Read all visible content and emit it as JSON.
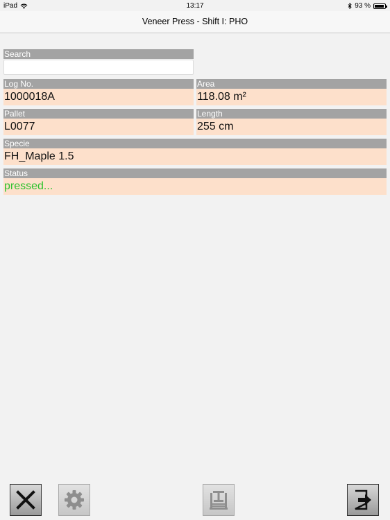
{
  "status_bar": {
    "device": "iPad",
    "time": "13:17",
    "battery": "93 %",
    "battery_level": 0.93
  },
  "header": {
    "title": "Veneer Press - Shift I: PHO"
  },
  "search": {
    "label": "Search",
    "value": "",
    "placeholder": ""
  },
  "fields": {
    "log_no": {
      "label": "Log No.",
      "value": "1000018A"
    },
    "area": {
      "label": "Area",
      "value": "118.08 m²"
    },
    "pallet": {
      "label": "Pallet",
      "value": "L0077"
    },
    "length": {
      "label": "Length",
      "value": "255 cm"
    },
    "specie": {
      "label": "Specie",
      "value": "FH_Maple 1.5"
    },
    "status": {
      "label": "Status",
      "value": "pressed...",
      "color": "#2ec22e"
    }
  },
  "toolbar": {
    "buttons": [
      {
        "icon": "close-icon",
        "enabled": true
      },
      {
        "icon": "gear-icon",
        "enabled": false
      },
      {
        "icon": "press-icon",
        "enabled": false
      },
      {
        "icon": "exit-icon",
        "enabled": true
      }
    ]
  },
  "colors": {
    "label_bg": "#a3a3a3",
    "value_bg": "#fde0cb",
    "background": "#f2f2f2"
  }
}
